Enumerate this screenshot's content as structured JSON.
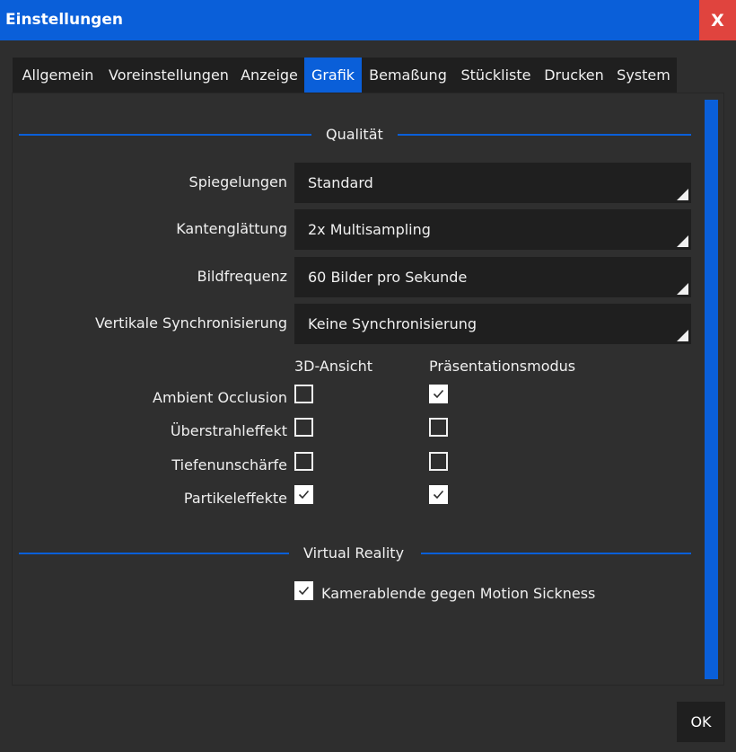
{
  "window": {
    "title": "Einstellungen",
    "close_label": "X"
  },
  "tabs": [
    {
      "label": "Allgemein"
    },
    {
      "label": "Voreinstellungen"
    },
    {
      "label": "Anzeige"
    },
    {
      "label": "Grafik"
    },
    {
      "label": "Bemaßung"
    },
    {
      "label": "Stückliste"
    },
    {
      "label": "Drucken"
    },
    {
      "label": "System"
    }
  ],
  "active_tab": "Grafik",
  "quality": {
    "title": "Qualität",
    "settings": [
      {
        "label": "Spiegelungen",
        "value": "Standard"
      },
      {
        "label": "Kantenglättung",
        "value": "2x Multisampling"
      },
      {
        "label": "Bildfrequenz",
        "value": "60 Bilder pro Sekunde"
      },
      {
        "label": "Vertikale Synchronisierung",
        "value": "Keine Synchronisierung"
      }
    ],
    "columns": [
      "3D-Ansicht",
      "Präsentationsmodus"
    ],
    "effects": [
      {
        "label": "Ambient Occlusion",
        "view3d": false,
        "presentation": true
      },
      {
        "label": "Überstrahleffekt",
        "view3d": false,
        "presentation": false
      },
      {
        "label": "Tiefenunschärfe",
        "view3d": false,
        "presentation": false
      },
      {
        "label": "Partikeleffekte",
        "view3d": true,
        "presentation": true
      }
    ]
  },
  "vr": {
    "title": "Virtual Reality",
    "option_label": "Kamerablende gegen Motion Sickness",
    "option_checked": true
  },
  "footer": {
    "ok_label": "OK"
  },
  "colors": {
    "accent": "#0a5fd9",
    "close": "#e0443e",
    "background": "#2e2e2e",
    "field": "#1f1f1f"
  }
}
